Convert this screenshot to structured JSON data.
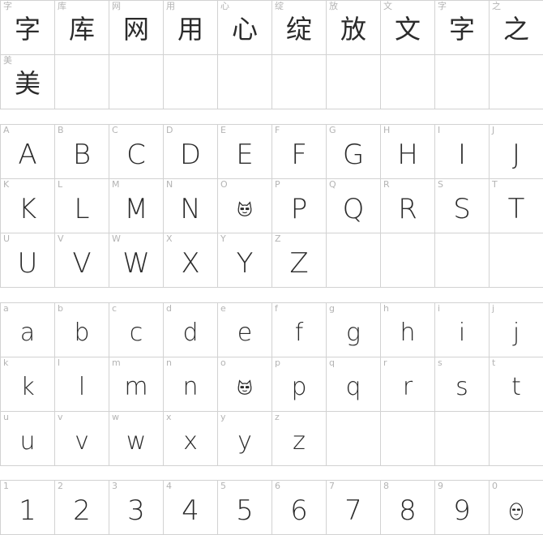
{
  "sections": [
    {
      "id": "cjk",
      "cells": [
        {
          "label": "字",
          "glyph": "字",
          "kind": "cjk"
        },
        {
          "label": "库",
          "glyph": "库",
          "kind": "cjk"
        },
        {
          "label": "网",
          "glyph": "网",
          "kind": "cjk"
        },
        {
          "label": "用",
          "glyph": "用",
          "kind": "cjk"
        },
        {
          "label": "心",
          "glyph": "心",
          "kind": "cjk"
        },
        {
          "label": "绽",
          "glyph": "绽",
          "kind": "cjk"
        },
        {
          "label": "放",
          "glyph": "放",
          "kind": "cjk"
        },
        {
          "label": "文",
          "glyph": "文",
          "kind": "cjk"
        },
        {
          "label": "字",
          "glyph": "字",
          "kind": "cjk"
        },
        {
          "label": "之",
          "glyph": "之",
          "kind": "cjk"
        },
        {
          "label": "美",
          "glyph": "美",
          "kind": "cjk"
        },
        {
          "label": "",
          "glyph": "",
          "kind": "empty"
        },
        {
          "label": "",
          "glyph": "",
          "kind": "empty"
        },
        {
          "label": "",
          "glyph": "",
          "kind": "empty"
        },
        {
          "label": "",
          "glyph": "",
          "kind": "empty"
        },
        {
          "label": "",
          "glyph": "",
          "kind": "empty"
        },
        {
          "label": "",
          "glyph": "",
          "kind": "empty"
        },
        {
          "label": "",
          "glyph": "",
          "kind": "empty"
        },
        {
          "label": "",
          "glyph": "",
          "kind": "empty"
        },
        {
          "label": "",
          "glyph": "",
          "kind": "empty"
        }
      ]
    },
    {
      "id": "upper",
      "cells": [
        {
          "label": "A",
          "glyph": "A"
        },
        {
          "label": "B",
          "glyph": "B"
        },
        {
          "label": "C",
          "glyph": "C"
        },
        {
          "label": "D",
          "glyph": "D"
        },
        {
          "label": "E",
          "glyph": "E"
        },
        {
          "label": "F",
          "glyph": "F"
        },
        {
          "label": "G",
          "glyph": "G"
        },
        {
          "label": "H",
          "glyph": "H"
        },
        {
          "label": "I",
          "glyph": "I"
        },
        {
          "label": "J",
          "glyph": "J"
        },
        {
          "label": "K",
          "glyph": "K"
        },
        {
          "label": "L",
          "glyph": "L"
        },
        {
          "label": "M",
          "glyph": "M"
        },
        {
          "label": "N",
          "glyph": "N"
        },
        {
          "label": "O",
          "glyph": "",
          "kind": "cat"
        },
        {
          "label": "P",
          "glyph": "P"
        },
        {
          "label": "Q",
          "glyph": "Q"
        },
        {
          "label": "R",
          "glyph": "R"
        },
        {
          "label": "S",
          "glyph": "S"
        },
        {
          "label": "T",
          "glyph": "T"
        },
        {
          "label": "U",
          "glyph": "U"
        },
        {
          "label": "V",
          "glyph": "V"
        },
        {
          "label": "W",
          "glyph": "W"
        },
        {
          "label": "X",
          "glyph": "X"
        },
        {
          "label": "Y",
          "glyph": "Y"
        },
        {
          "label": "Z",
          "glyph": "Z"
        },
        {
          "label": "",
          "glyph": "",
          "kind": "empty"
        },
        {
          "label": "",
          "glyph": "",
          "kind": "empty"
        },
        {
          "label": "",
          "glyph": "",
          "kind": "empty"
        },
        {
          "label": "",
          "glyph": "",
          "kind": "empty"
        }
      ]
    },
    {
      "id": "lower",
      "cells": [
        {
          "label": "a",
          "glyph": "a"
        },
        {
          "label": "b",
          "glyph": "b"
        },
        {
          "label": "c",
          "glyph": "c"
        },
        {
          "label": "d",
          "glyph": "d"
        },
        {
          "label": "e",
          "glyph": "e"
        },
        {
          "label": "f",
          "glyph": "f"
        },
        {
          "label": "g",
          "glyph": "g"
        },
        {
          "label": "h",
          "glyph": "h"
        },
        {
          "label": "i",
          "glyph": "i"
        },
        {
          "label": "j",
          "glyph": "j"
        },
        {
          "label": "k",
          "glyph": "k"
        },
        {
          "label": "l",
          "glyph": "l"
        },
        {
          "label": "m",
          "glyph": "m"
        },
        {
          "label": "n",
          "glyph": "n"
        },
        {
          "label": "o",
          "glyph": "",
          "kind": "cat"
        },
        {
          "label": "p",
          "glyph": "p"
        },
        {
          "label": "q",
          "glyph": "q"
        },
        {
          "label": "r",
          "glyph": "r"
        },
        {
          "label": "s",
          "glyph": "s"
        },
        {
          "label": "t",
          "glyph": "t"
        },
        {
          "label": "u",
          "glyph": "u"
        },
        {
          "label": "v",
          "glyph": "v"
        },
        {
          "label": "w",
          "glyph": "w"
        },
        {
          "label": "x",
          "glyph": "x"
        },
        {
          "label": "y",
          "glyph": "y"
        },
        {
          "label": "z",
          "glyph": "z"
        },
        {
          "label": "",
          "glyph": "",
          "kind": "empty"
        },
        {
          "label": "",
          "glyph": "",
          "kind": "empty"
        },
        {
          "label": "",
          "glyph": "",
          "kind": "empty"
        },
        {
          "label": "",
          "glyph": "",
          "kind": "empty"
        }
      ]
    },
    {
      "id": "digits",
      "cells": [
        {
          "label": "1",
          "glyph": "1"
        },
        {
          "label": "2",
          "glyph": "2"
        },
        {
          "label": "3",
          "glyph": "3"
        },
        {
          "label": "4",
          "glyph": "4"
        },
        {
          "label": "5",
          "glyph": "5"
        },
        {
          "label": "6",
          "glyph": "6"
        },
        {
          "label": "7",
          "glyph": "7"
        },
        {
          "label": "8",
          "glyph": "8"
        },
        {
          "label": "9",
          "glyph": "9"
        },
        {
          "label": "0",
          "glyph": "",
          "kind": "cat-egg"
        }
      ]
    }
  ]
}
